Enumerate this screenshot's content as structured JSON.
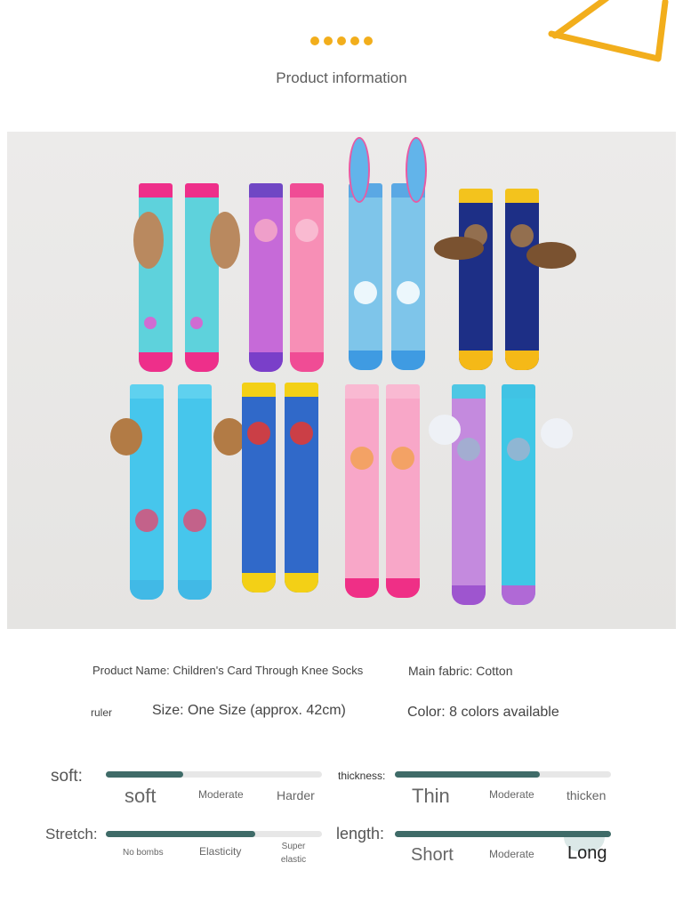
{
  "header": {
    "title": "Product information",
    "accent_color": "#f2ae1c"
  },
  "photo": {
    "description_icon": "socks-product-photo"
  },
  "details": {
    "product_name": "Product Name: Children's Card Through Knee Socks",
    "main_fabric": "Main fabric: Cotton",
    "ruler_label": "ruler",
    "size": "Size: One Size (approx. 42cm)",
    "color": "Color: 8 colors available"
  },
  "scales": {
    "soft": {
      "label": "soft:",
      "options": [
        "soft",
        "Moderate",
        "Harder"
      ],
      "level": 0.36
    },
    "thickness": {
      "label": "thickness:",
      "options": [
        "Thin",
        "Moderate",
        "thicken"
      ],
      "level": 0.67
    },
    "stretch": {
      "label": "Stretch:",
      "options": [
        "No bombs",
        "Elasticity",
        "Super elastic"
      ],
      "level": 0.69
    },
    "length": {
      "label": "length:",
      "options": [
        "Short",
        "Moderate",
        "Long"
      ],
      "level": 1.0
    },
    "bar_color": "#3f6b68"
  }
}
